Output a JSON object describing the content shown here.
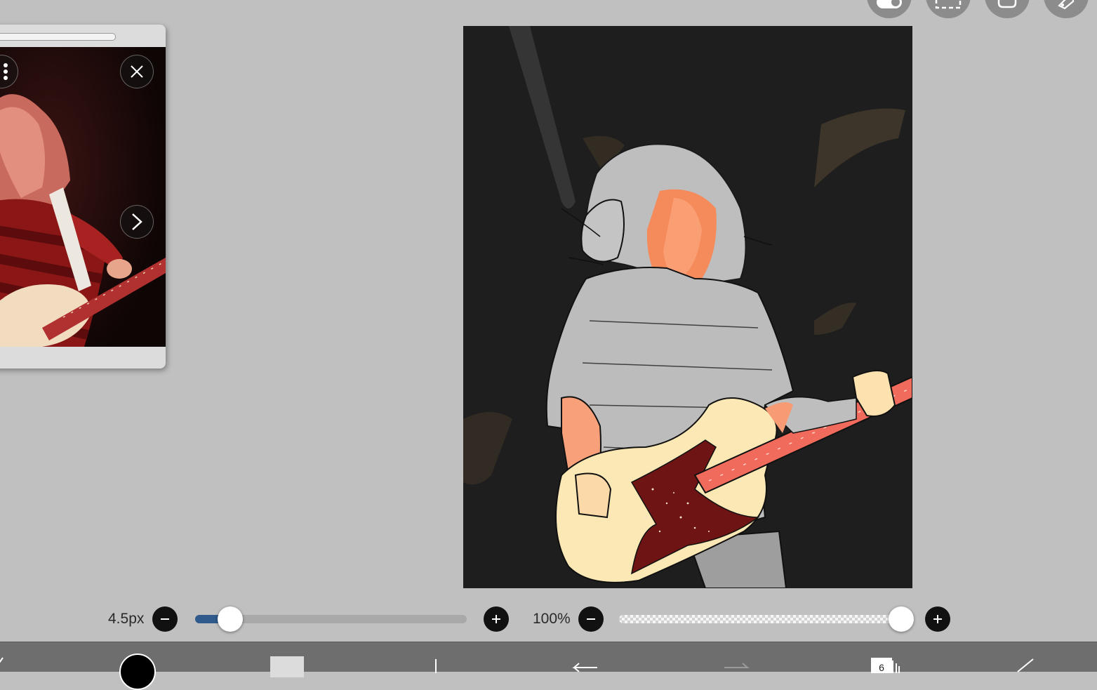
{
  "top_tools": {
    "icons": [
      "toggle-icon",
      "selection-icon",
      "layer-icon",
      "ruler-icon"
    ]
  },
  "reference": {
    "icons": [
      "menu-dots-icon",
      "close-icon",
      "next-arrow-icon"
    ]
  },
  "brush_size": {
    "label": "4.5px",
    "value": 4.5,
    "fraction": 0.13
  },
  "opacity": {
    "label": "100%",
    "value": 100
  },
  "toolbar": {
    "layer_count": "6",
    "icons": [
      "color-swatch-icon",
      "secondary-color-icon",
      "brush-tool-icon",
      "undo-icon",
      "redo-icon",
      "layers-icon",
      "edit-icon"
    ],
    "colors": {
      "primary": "#000000",
      "secondary": "#dcdcdc",
      "slider_accent": "#2f5a8b"
    }
  }
}
